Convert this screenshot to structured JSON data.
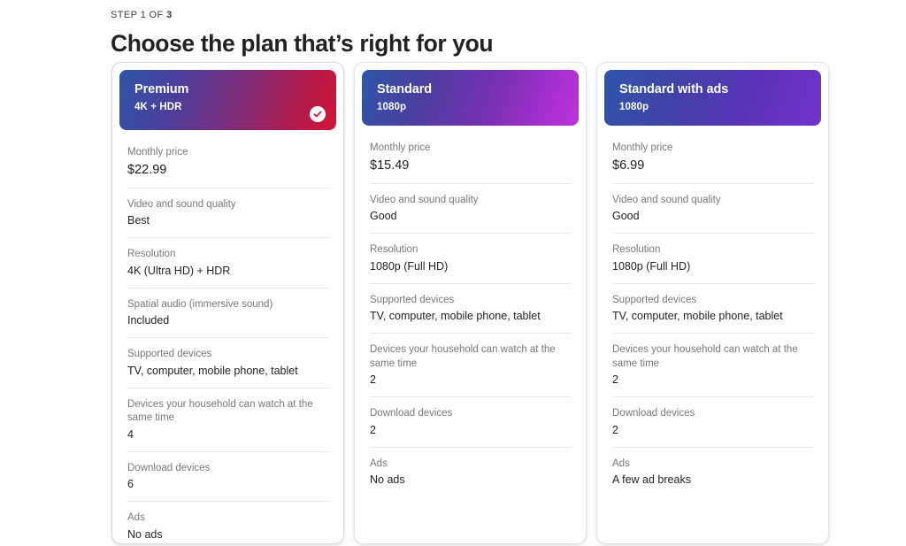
{
  "header": {
    "step_prefix": "STEP 1 OF ",
    "step_current": "3",
    "title": "Choose the plan that’s right for you"
  },
  "colors": {
    "premium_gradient_start": "#2f55aa",
    "premium_gradient_end": "#d2163a",
    "standard_gradient_start": "#2f55aa",
    "standard_gradient_end": "#bb33dd",
    "standard_ads_gradient_start": "#2f55aa",
    "standard_ads_gradient_end": "#7034cc",
    "check_mark": "#cf1b3b",
    "label_text": "#787878",
    "value_text": "#232323"
  },
  "plans": [
    {
      "id": "premium",
      "name": "Premium",
      "subtitle": "4K + HDR",
      "selected": true,
      "check_icon": "check-circle-icon",
      "features": [
        {
          "label": "Monthly price",
          "value": "$22.99"
        },
        {
          "label": "Video and sound quality",
          "value": "Best"
        },
        {
          "label": "Resolution",
          "value": "4K (Ultra HD) + HDR"
        },
        {
          "label": "Spatial audio (immersive sound)",
          "value": "Included"
        },
        {
          "label": "Supported devices",
          "value": "TV, computer, mobile phone, tablet"
        },
        {
          "label": "Devices your household can watch at the same time",
          "value": "4"
        },
        {
          "label": "Download devices",
          "value": "6"
        },
        {
          "label": "Ads",
          "value": "No ads"
        }
      ]
    },
    {
      "id": "standard",
      "name": "Standard",
      "subtitle": "1080p",
      "selected": false,
      "features": [
        {
          "label": "Monthly price",
          "value": "$15.49"
        },
        {
          "label": "Video and sound quality",
          "value": "Good"
        },
        {
          "label": "Resolution",
          "value": "1080p (Full HD)"
        },
        {
          "label": "Supported devices",
          "value": "TV, computer, mobile phone, tablet"
        },
        {
          "label": "Devices your household can watch at the same time",
          "value": "2"
        },
        {
          "label": "Download devices",
          "value": "2"
        },
        {
          "label": "Ads",
          "value": "No ads"
        }
      ]
    },
    {
      "id": "standard-with-ads",
      "name": "Standard with ads",
      "subtitle": "1080p",
      "selected": false,
      "features": [
        {
          "label": "Monthly price",
          "value": "$6.99"
        },
        {
          "label": "Video and sound quality",
          "value": "Good"
        },
        {
          "label": "Resolution",
          "value": "1080p (Full HD)"
        },
        {
          "label": "Supported devices",
          "value": "TV, computer, mobile phone, tablet"
        },
        {
          "label": "Devices your household can watch at the same time",
          "value": "2"
        },
        {
          "label": "Download devices",
          "value": "2"
        },
        {
          "label": "Ads",
          "value": "A few ad breaks"
        }
      ]
    }
  ]
}
